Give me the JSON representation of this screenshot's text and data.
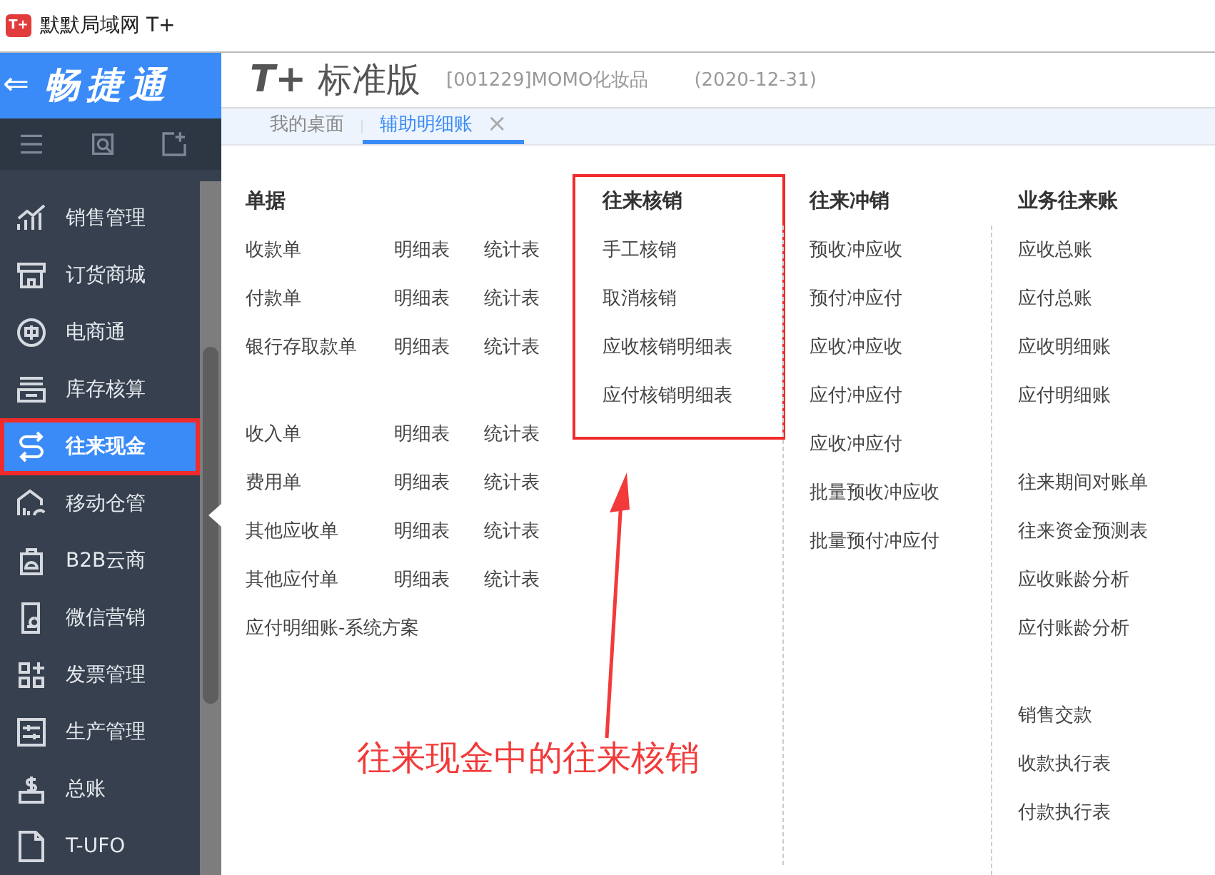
{
  "browser_tab": {
    "favicon": "T+",
    "title": "默默局域网 T+"
  },
  "brand": {
    "back": "⇐",
    "name": "畅捷通"
  },
  "header": {
    "logo": "T+",
    "edition": "标准版",
    "company": "[001229]MOMO化妆品",
    "date": "(2020-12-31)"
  },
  "tabs": [
    {
      "label": "我的桌面",
      "selected": false
    },
    {
      "label": "辅助明细账",
      "selected": true,
      "close": "×"
    }
  ],
  "sidebar": {
    "items": [
      {
        "label": "销售管理",
        "selected": false,
        "highlighted": false
      },
      {
        "label": "订货商城",
        "selected": false,
        "highlighted": false
      },
      {
        "label": "电商通",
        "selected": false,
        "highlighted": false
      },
      {
        "label": "库存核算",
        "selected": false,
        "highlighted": false
      },
      {
        "label": "往来现金",
        "selected": true,
        "highlighted": true
      },
      {
        "label": "移动仓管",
        "selected": false,
        "highlighted": false
      },
      {
        "label": "B2B云商",
        "selected": false,
        "highlighted": false
      },
      {
        "label": "微信营销",
        "selected": false,
        "highlighted": false
      },
      {
        "label": "发票管理",
        "selected": false,
        "highlighted": false
      },
      {
        "label": "生产管理",
        "selected": false,
        "highlighted": false
      },
      {
        "label": "总账",
        "selected": false,
        "highlighted": false
      },
      {
        "label": "T-UFO",
        "selected": false,
        "highlighted": false
      }
    ]
  },
  "columns": [
    {
      "title": "单据",
      "highlighted": false,
      "groups": [
        [
          [
            "收款单",
            "明细表",
            "统计表"
          ],
          [
            "付款单",
            "明细表",
            "统计表"
          ],
          [
            "银行存取款单",
            "明细表",
            "统计表"
          ]
        ],
        [
          [
            "收入单",
            "明细表",
            "统计表"
          ],
          [
            "费用单",
            "明细表",
            "统计表"
          ],
          [
            "其他应收单",
            "明细表",
            "统计表"
          ],
          [
            "其他应付单",
            "明细表",
            "统计表"
          ],
          [
            "应付明细账-系统方案"
          ]
        ]
      ]
    },
    {
      "title": "往来核销",
      "highlighted": true,
      "groups": [
        [
          [
            "手工核销"
          ],
          [
            "取消核销"
          ],
          [
            "应收核销明细表"
          ],
          [
            "应付核销明细表"
          ]
        ]
      ]
    },
    {
      "title": "往来冲销",
      "highlighted": false,
      "groups": [
        [
          [
            "预收冲应收"
          ],
          [
            "预付冲应付"
          ],
          [
            "应收冲应收"
          ],
          [
            "应付冲应付"
          ],
          [
            "应收冲应付"
          ],
          [
            "批量预收冲应收"
          ],
          [
            "批量预付冲应付"
          ]
        ]
      ]
    },
    {
      "title": "业务往来账",
      "highlighted": false,
      "groups": [
        [
          [
            "应收总账"
          ],
          [
            "应付总账"
          ],
          [
            "应收明细账"
          ],
          [
            "应付明细账"
          ]
        ],
        [
          [
            "往来期间对账单"
          ],
          [
            "往来资金预测表"
          ],
          [
            "应收账龄分析"
          ],
          [
            "应付账龄分析"
          ]
        ],
        [
          [
            "销售交款"
          ],
          [
            "收款执行表"
          ],
          [
            "付款执行表"
          ]
        ]
      ]
    }
  ],
  "annotation": {
    "text": "往来现金中的往来核销"
  }
}
